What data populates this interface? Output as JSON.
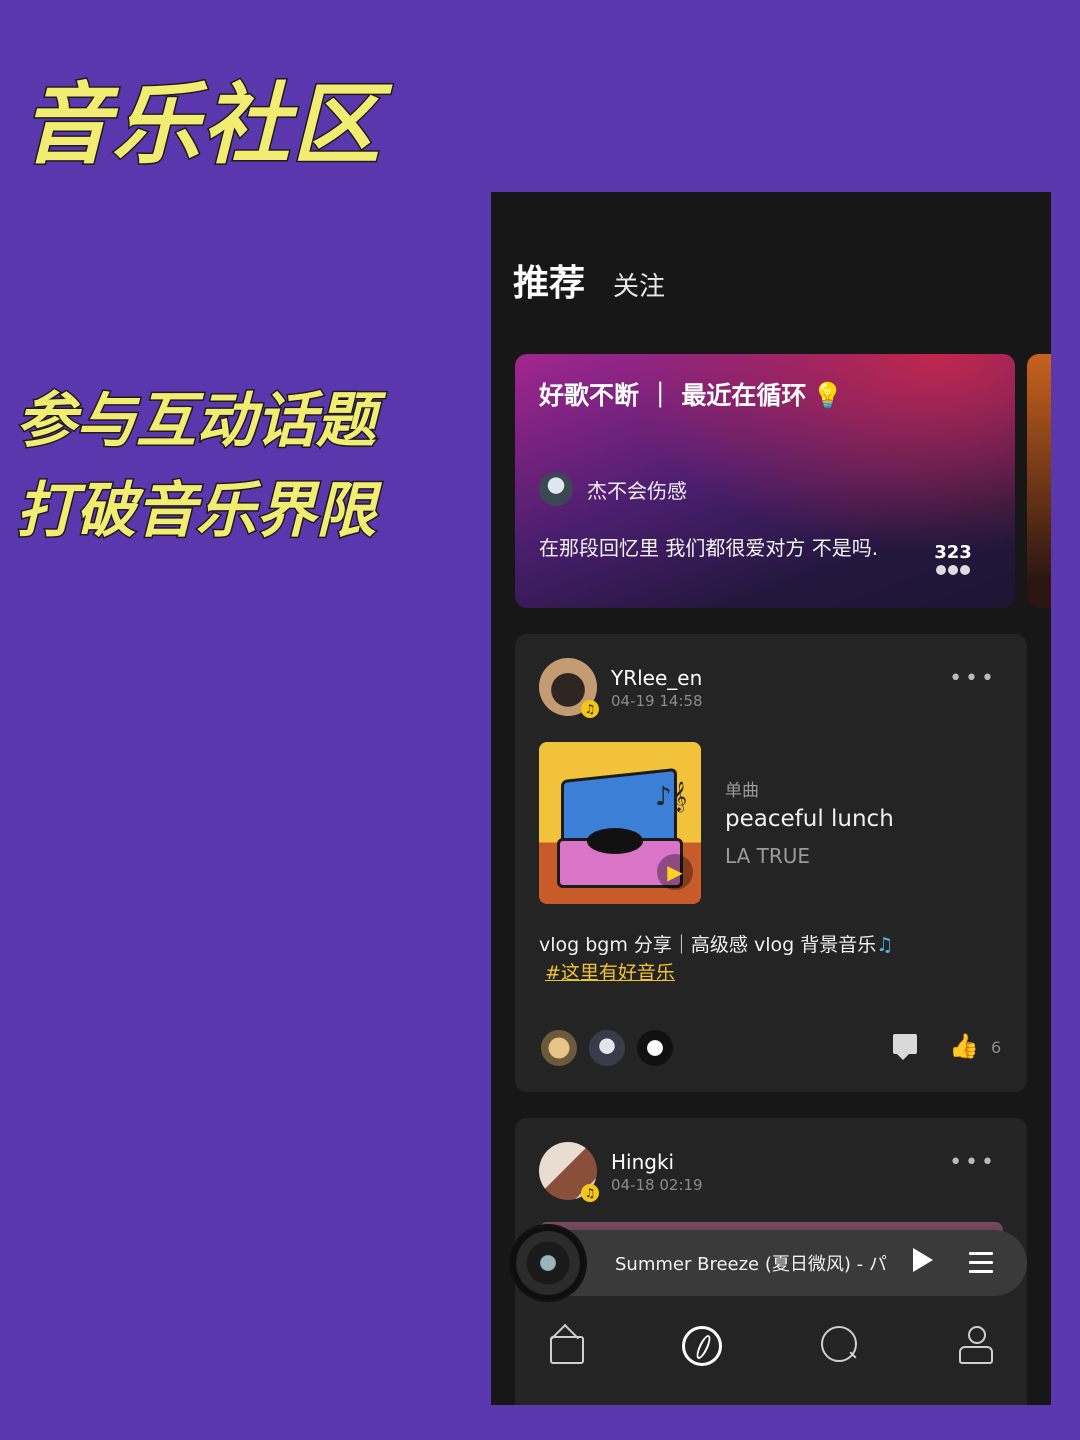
{
  "promo": {
    "title": "音乐社区",
    "line1": "参与互动话题",
    "line2": "打破音乐界限"
  },
  "tabs": {
    "recommend": "推荐",
    "follow": "关注"
  },
  "topic": {
    "title": "好歌不断 ｜ 最近在循环",
    "username": "杰不会伤感",
    "text": "在那段回忆里 我们都很爱对方 不是吗.",
    "participants": "323"
  },
  "posts": [
    {
      "username": "YRlee_en",
      "time": "04-19 14:58",
      "song_type": "单曲",
      "song_title": "peaceful lunch",
      "song_artist": "LA TRUE",
      "text": "vlog bgm 分享｜高级感 vlog 背景音乐",
      "tag": "#这里有好音乐",
      "like_count": "6"
    },
    {
      "username": "Hingki",
      "time": "04-18 02:19"
    }
  ],
  "player": {
    "title": "Summer Breeze (夏日微风) - パ"
  },
  "colors": {
    "background": "#5b37ad",
    "promo_text": "#f3ec72",
    "tag": "#f1c431"
  },
  "icons": {
    "bulb": "lightbulb-icon",
    "note": "music-note-icon",
    "nav": [
      "home-icon",
      "discover-icon",
      "search-icon",
      "profile-icon"
    ]
  }
}
